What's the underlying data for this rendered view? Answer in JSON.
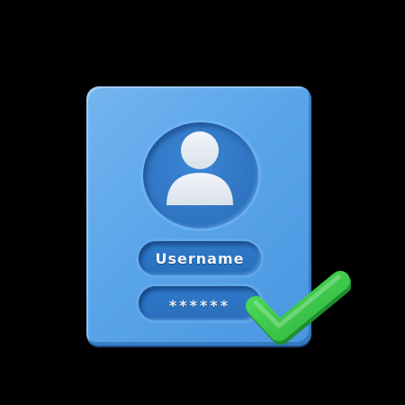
{
  "card": {
    "username_label": "Username",
    "password_mask": "******"
  },
  "icons": {
    "avatar": "user-silhouette-icon",
    "check": "checkmark-icon"
  },
  "colors": {
    "card": "#5aa5ea",
    "card_dark": "#2f76c8",
    "inset": "#2e73c0",
    "silhouette": "#e9eef5",
    "check": "#39c94a",
    "check_dark": "#23a033"
  }
}
